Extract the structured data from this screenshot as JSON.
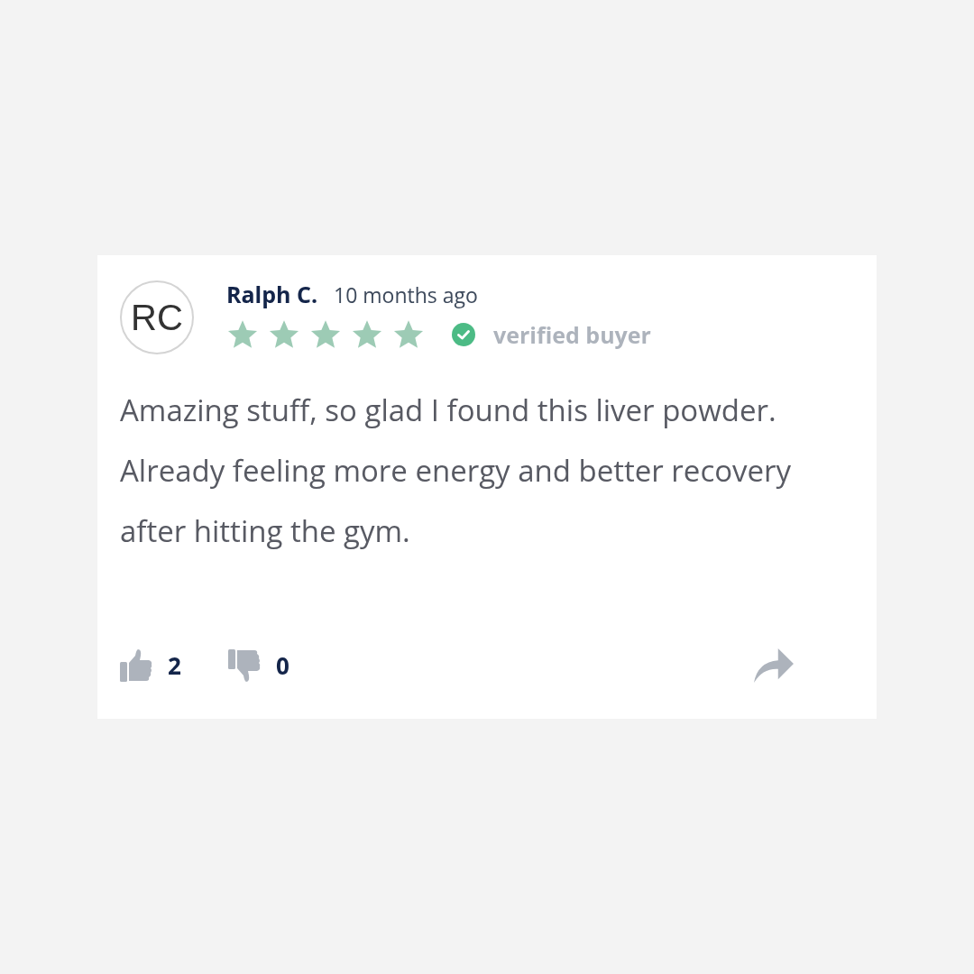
{
  "review": {
    "avatar_initials": "RC",
    "author": "Ralph C.",
    "time": "10 months ago",
    "stars": 5,
    "verified": true,
    "verified_label": "verified buyer",
    "text": "Amazing stuff, so glad I found this liver powder. Already feeling more energy and better recovery after hitting the gym.",
    "helpful_count": "2",
    "unhelpful_count": "0"
  }
}
